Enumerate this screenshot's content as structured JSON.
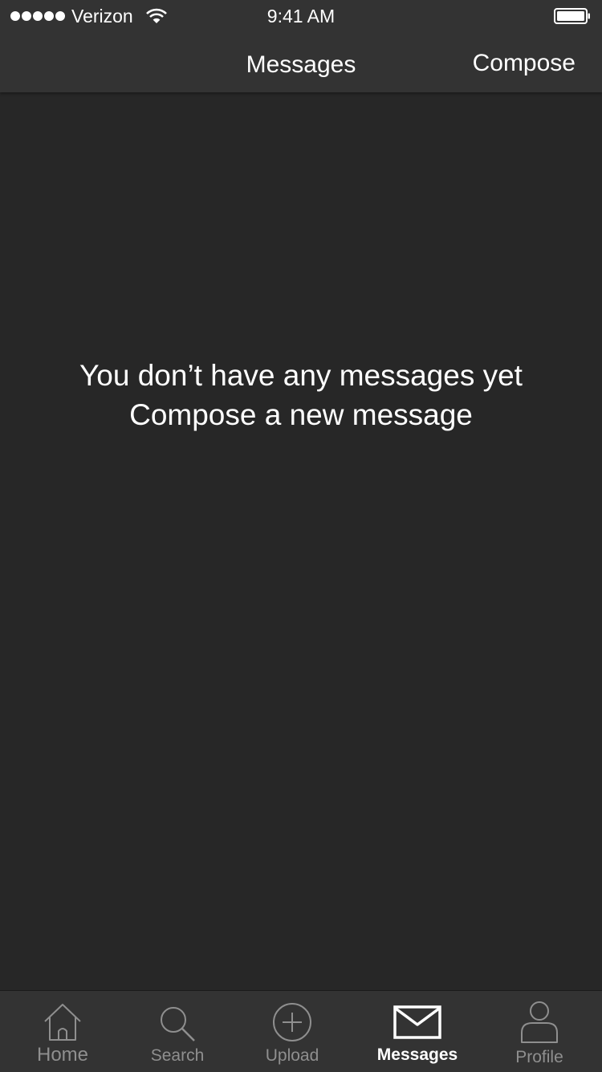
{
  "status_bar": {
    "carrier": "Verizon",
    "time": "9:41 AM",
    "signal_icon": "signal-dots-icon",
    "wifi_icon": "wifi-icon",
    "battery_icon": "battery-icon"
  },
  "nav": {
    "title": "Messages",
    "compose_label": "Compose"
  },
  "empty_state": {
    "line1": "You don’t have any messages yet",
    "line2": "Compose a new message"
  },
  "tabs": [
    {
      "label": "Home",
      "icon": "home-icon"
    },
    {
      "label": "Search",
      "icon": "search-icon"
    },
    {
      "label": "Upload",
      "icon": "plus-circle-icon"
    },
    {
      "label": "Messages",
      "icon": "envelope-icon"
    },
    {
      "label": "Profile",
      "icon": "person-icon"
    }
  ],
  "colors": {
    "background": "#272727",
    "bars": "#333333",
    "active": "#ffffff",
    "inactive": "#8f8f8f"
  },
  "active_tab": "Messages"
}
